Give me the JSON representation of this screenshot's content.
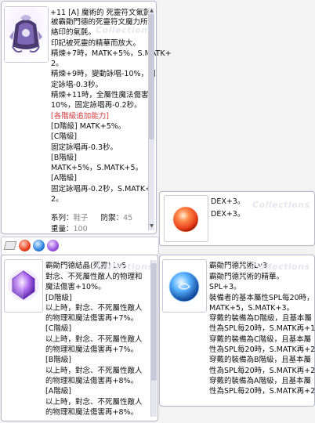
{
  "window_main": {
    "title": "+11 [A] 魔術的 死靈符文氣氈",
    "lines": [
      {
        "t": "被霸勛門德的死靈符文魔力所"
      },
      {
        "t": "絡印的氣氈。"
      },
      {
        "t": "印記被死靈的精華而放大。"
      },
      {
        "t": "精煉+7時，MATK+5%，S.MATK+"
      },
      {
        "t": "2。"
      },
      {
        "t": "精煉+9時，變動詠唱-10%，固"
      },
      {
        "t": "定詠唱-0.3秒。"
      },
      {
        "t": "精煉+11時，全屬性魔法傷害+"
      },
      {
        "t": "10%，固定詠唱再-0.2秒。"
      },
      {
        "t": "[各階級追加能力]",
        "red": true
      },
      {
        "t": "[D階級] MATK+5%。"
      },
      {
        "t": "[C階級]"
      },
      {
        "t": " 固定詠唱再-0.3秒。"
      },
      {
        "t": "[B階級]"
      },
      {
        "t": " MATK+5%，S.MATK+5。"
      },
      {
        "t": "[A階級]"
      },
      {
        "t": " 固定詠唱再-0.2秒，S.MATK+"
      },
      {
        "t": "2。"
      }
    ],
    "type_label": "系列：",
    "type_value": "鞋子",
    "def_label": "防禦：",
    "def_value": "45",
    "weight_label": "重量：",
    "weight_value": "100"
  },
  "window_dex": {
    "title": "DEX+3。",
    "line": "DEX+3。"
  },
  "window_crystal": {
    "title": "霸勛門德結晶(死靈) Lv5",
    "lines": [
      "對念、不死屬性敵人的物理和",
      "魔法傷害+10%。",
      "[D階級]",
      "以上時，對念、不死屬性敵人",
      "的物理和魔法傷害再+7%。",
      "[C階級]",
      "以上時，對念、不死屬性敵人",
      "的物理和魔法傷害再+7%。",
      "[B階級]",
      "以上時，對念、不死屬性敵人",
      "的物理和魔法傷害再+8%。",
      "[A階級]",
      "以上時，對念、不死屬性敵人",
      "的物理和魔法傷害再+8%。"
    ]
  },
  "window_spell": {
    "title": "霸勛門德咒術Lv3",
    "lines": [
      "霸勛門德咒術的精華。",
      "SPL+3。",
      "裝備者的基本屬性SPL每20時，",
      "MATK+5，S.MATK+3。",
      "穿戴的裝備為D階級，且基本屬",
      "性為SPL每20時，S.MATK再+1。",
      "穿戴的裝備為C階級，且基本屬",
      "性為SPL每20時，S.MATK再+2。",
      "穿戴的裝備為B階級，且基本屬",
      "性為SPL每20時，S.MATK再+2。",
      "穿戴的裝備為A階級，且基本屬",
      "性為SPL每20時，S.MATK再+2。"
    ]
  },
  "watermark": "Collections",
  "colors": {
    "border": "#b8b8c8",
    "red_text": "#d23a3a",
    "orb_red": "#e8401c",
    "orb_blue": "#2a7fe0",
    "orb_purple": "#7a3fd0"
  }
}
